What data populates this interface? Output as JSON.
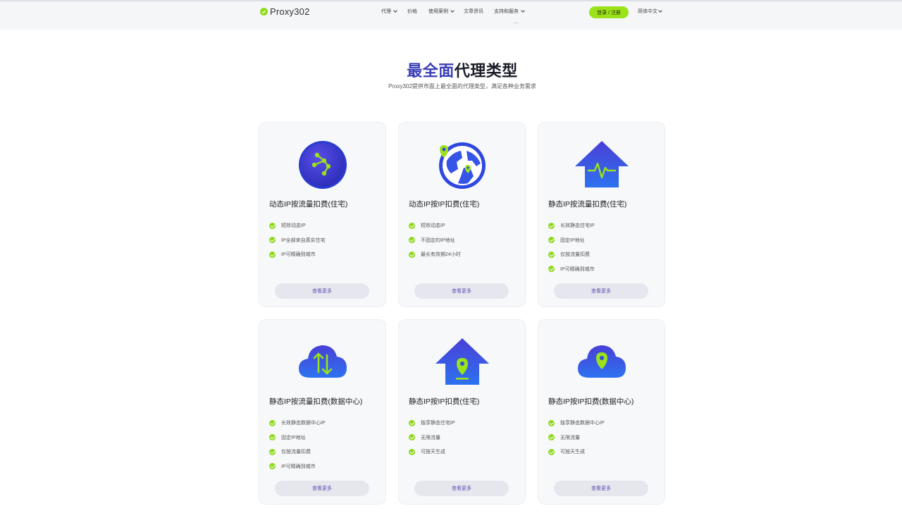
{
  "header": {
    "logo_text": "Proxy302",
    "nav": [
      {
        "label": "代理",
        "has_dropdown": true
      },
      {
        "label": "价格",
        "has_dropdown": false
      },
      {
        "label": "使用案例",
        "has_dropdown": true
      },
      {
        "label": "文章资讯",
        "has_dropdown": false
      },
      {
        "label": "支持和服务",
        "has_dropdown": true
      }
    ],
    "login_label": "登录 / 注册",
    "language_label": "简体中文"
  },
  "hero": {
    "title_accent": "最全面",
    "title_rest": "代理类型",
    "subtitle": "Proxy302提供市面上最全面的代理类型，满足各种业务需求"
  },
  "cards": [
    {
      "title": "动态IP按流量扣费(住宅)",
      "icon": "globe-network-icon",
      "features": [
        "短效动态IP",
        "IP全部来自真实住宅",
        "IP可精确到城市"
      ],
      "button": "查看更多"
    },
    {
      "title": "动态IP按IP扣费(住宅)",
      "icon": "globe-location-icon",
      "features": [
        "短效动态IP",
        "不固定的IP地址",
        "最长有效期24小时"
      ],
      "button": "查看更多"
    },
    {
      "title": "静态IP按流量扣费(住宅)",
      "icon": "house-pulse-icon",
      "features": [
        "长效静态住宅IP",
        "固定IP地址",
        "仅按流量扣费",
        "IP可精确到城市"
      ],
      "button": "查看更多"
    },
    {
      "title": "静态IP按流量扣费(数据中心)",
      "icon": "cloud-transfer-icon",
      "features": [
        "长效静态数据中心IP",
        "固定IP地址",
        "仅按流量扣费",
        "IP可精确到城市"
      ],
      "button": "查看更多"
    },
    {
      "title": "静态IP按IP扣费(住宅)",
      "icon": "house-location-icon",
      "features": [
        "独享静态住宅IP",
        "无限流量",
        "可按天生成"
      ],
      "button": "查看更多"
    },
    {
      "title": "静态IP按IP扣费(数据中心)",
      "icon": "cloud-location-icon",
      "features": [
        "独享静态数据中心IP",
        "无限流量",
        "可按天生成"
      ],
      "button": "查看更多"
    }
  ],
  "colors": {
    "accent_green": "#9be21a",
    "brand_blue": "#3b3fb8",
    "icon_gradient_top": "#4640d8",
    "icon_gradient_bottom": "#2e6ff0",
    "card_bg": "#f7f8fa",
    "button_bg": "#e6e7ee"
  }
}
